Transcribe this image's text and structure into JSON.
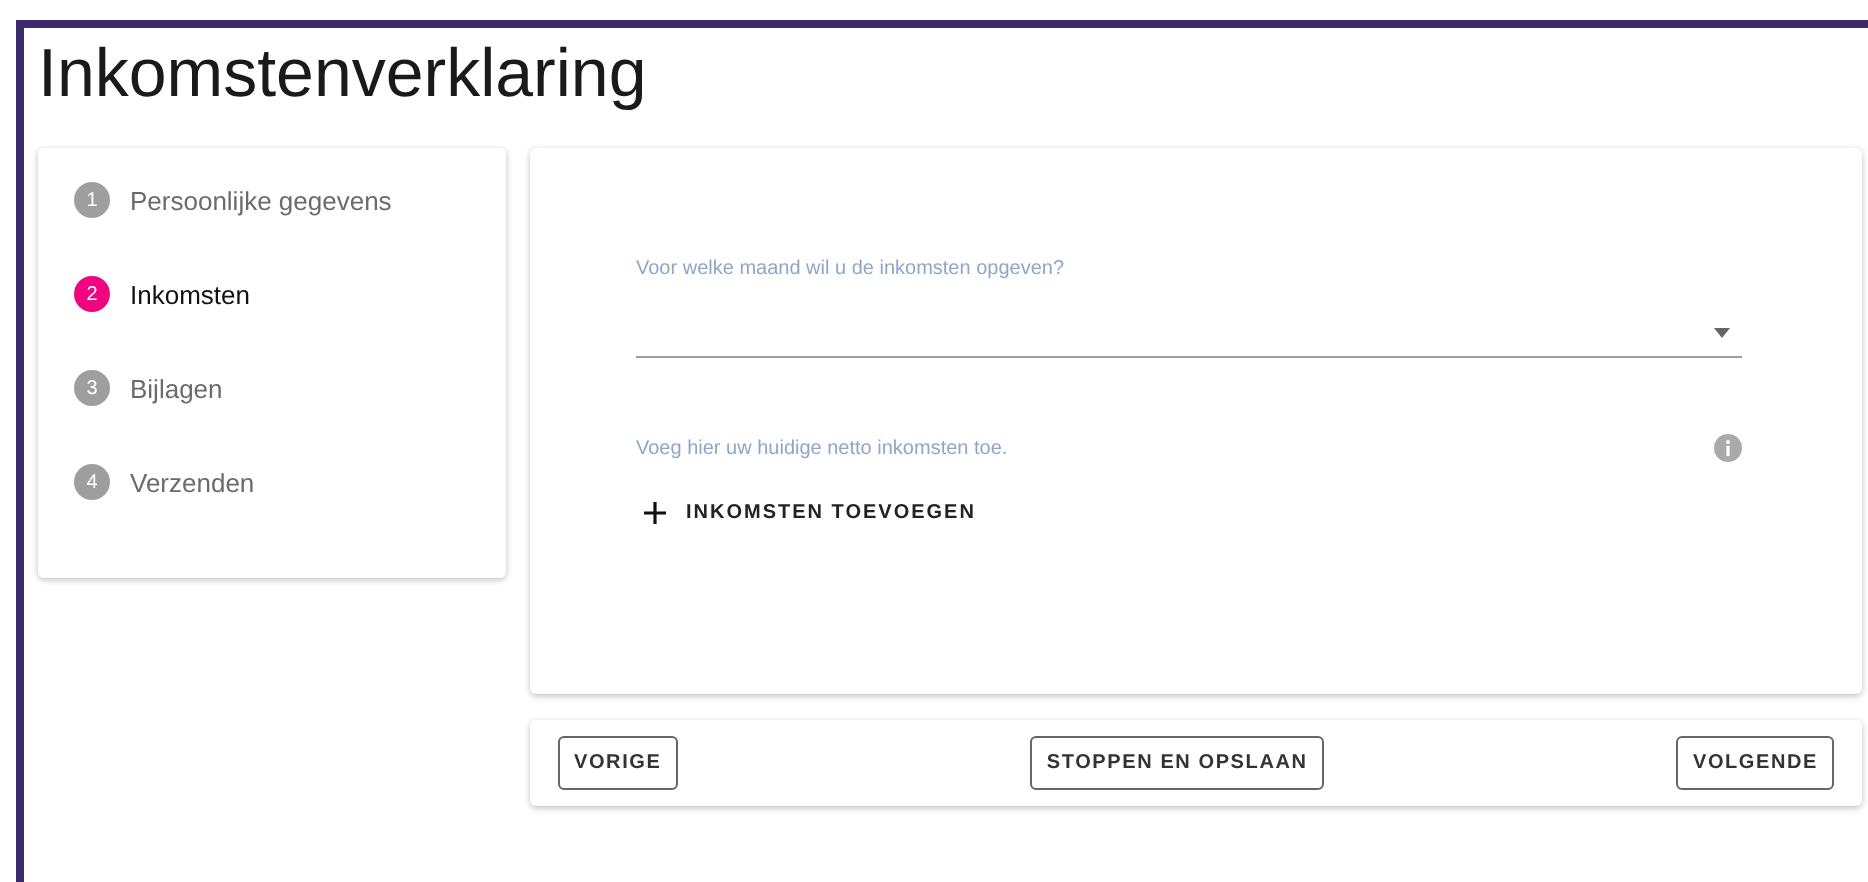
{
  "title": "Inkomstenverklaring",
  "steps": [
    {
      "number": "1",
      "label": "Persoonlijke gegevens",
      "selected": false
    },
    {
      "number": "2",
      "label": "Inkomsten",
      "selected": true
    },
    {
      "number": "3",
      "label": "Bijlagen",
      "selected": false
    },
    {
      "number": "4",
      "label": "Verzenden",
      "selected": false
    }
  ],
  "month_field": {
    "label": "Voor welke maand wil u de inkomsten opgeven?"
  },
  "income": {
    "hint": "Voeg hier uw huidige netto inkomsten toe.",
    "add_button": "INKOMSTEN TOEVOEGEN"
  },
  "footer_buttons": [
    {
      "label": "VORIGE"
    },
    {
      "label": "STOPPEN EN OPSLAAN"
    },
    {
      "label": "VOLGENDE"
    }
  ]
}
